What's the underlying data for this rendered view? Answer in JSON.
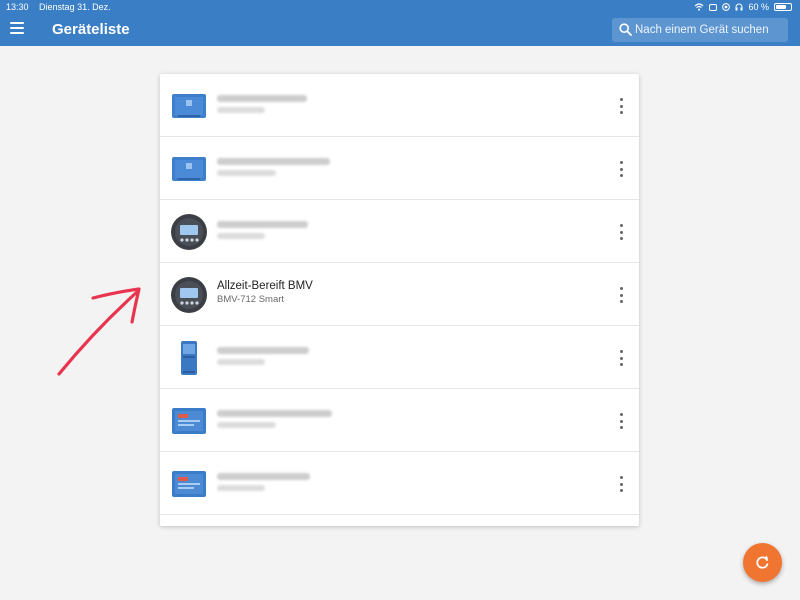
{
  "status_bar": {
    "time": "13:30",
    "date": "Dienstag 31. Dez.",
    "battery": "60 %",
    "battery_level_percent": 60
  },
  "app_bar": {
    "title": "Geräteliste",
    "menu_icon": "hamburger-menu-icon",
    "search_placeholder": "Nach einem Gerät suchen",
    "search_icon": "search-icon"
  },
  "device_list": {
    "items": [
      {
        "title": "",
        "subtitle": "",
        "blurred": true,
        "icon": "blue-charger-device-icon"
      },
      {
        "title": "",
        "subtitle": "",
        "blurred": true,
        "icon": "blue-charger-device-icon"
      },
      {
        "title": "",
        "subtitle": "",
        "blurred": true,
        "icon": "battery-monitor-device-icon"
      },
      {
        "title": "Allzeit-Bereift BMV",
        "subtitle": "BMV-712 Smart",
        "blurred": false,
        "icon": "battery-monitor-device-icon"
      },
      {
        "title": "",
        "subtitle": "",
        "blurred": true,
        "icon": "tall-blue-charger-device-icon"
      },
      {
        "title": "",
        "subtitle": "",
        "blurred": true,
        "icon": "solar-charge-controller-device-icon"
      },
      {
        "title": "",
        "subtitle": "",
        "blurred": true,
        "icon": "solar-charge-controller-device-icon"
      }
    ],
    "more_icon": "more-vert-icon"
  },
  "fab": {
    "icon": "refresh-icon"
  },
  "colors": {
    "primary": "#3a7ec6",
    "accent": "#ef7530",
    "annotation": "#e8344e",
    "background": "#f3f3f3"
  }
}
